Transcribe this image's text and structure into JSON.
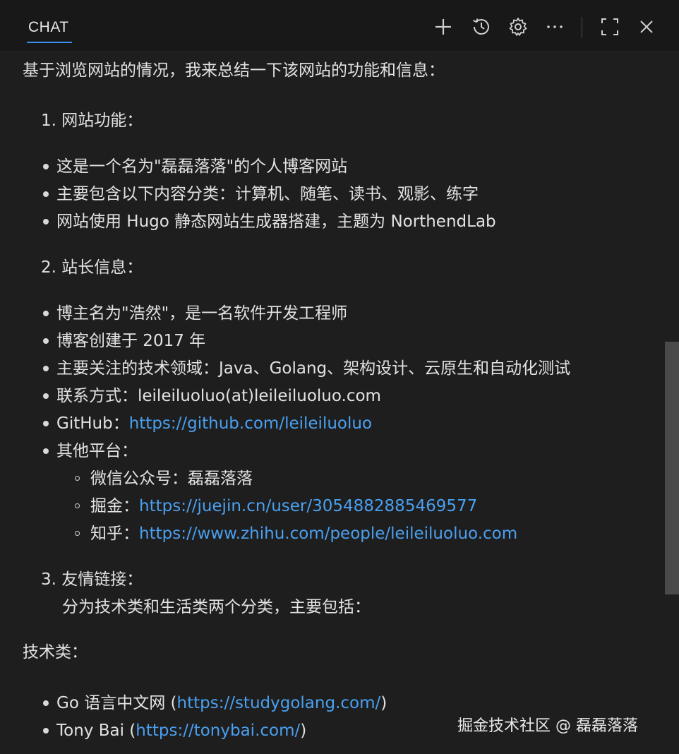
{
  "header": {
    "tab_label": "CHAT",
    "icons": [
      "plus-icon",
      "history-icon",
      "gear-icon",
      "more-icon",
      "maximize-icon",
      "close-icon"
    ]
  },
  "content": {
    "intro": "基于浏览网站的情况，我来总结一下该网站的功能和信息：",
    "section1": {
      "heading": "1. 网站功能：",
      "items": [
        "这是一个名为\"磊磊落落\"的个人博客网站",
        "主要包含以下内容分类：计算机、随笔、读书、观影、练字",
        "网站使用 Hugo 静态网站生成器搭建，主题为 NorthendLab"
      ]
    },
    "section2": {
      "heading": "2. 站长信息：",
      "items": [
        "博主名为\"浩然\"，是一名软件开发工程师",
        "博客创建于 2017 年",
        "主要关注的技术领域：Java、Golang、架构设计、云原生和自动化测试",
        "联系方式：leileiluoluo(at)leileiluoluo.com"
      ],
      "github_label": "GitHub：",
      "github_url": "https://github.com/leileiluoluo",
      "other_label": "其他平台：",
      "sub_items": {
        "wechat": "微信公众号：磊磊落落",
        "juejin_label": "掘金：",
        "juejin_url": "https://juejin.cn/user/3054882885469577",
        "zhihu_label": "知乎：",
        "zhihu_url": "https://www.zhihu.com/people/leileiluoluo.com"
      }
    },
    "section3": {
      "heading": "3. 友情链接：",
      "desc": "分为技术类和生活类两个分类，主要包括："
    },
    "tech_heading": "技术类：",
    "tech_links": [
      {
        "name": "Go 语言中文网 (",
        "url": "https://studygolang.com/",
        "suffix": ")"
      },
      {
        "name": "Tony Bai (",
        "url": "https://tonybai.com/",
        "suffix": ")"
      }
    ]
  },
  "watermark": "掘金技术社区 @ 磊磊落落",
  "colors": {
    "background": "#1e1e1e",
    "link": "#4aa0f0",
    "accent": "#3b8eea"
  }
}
